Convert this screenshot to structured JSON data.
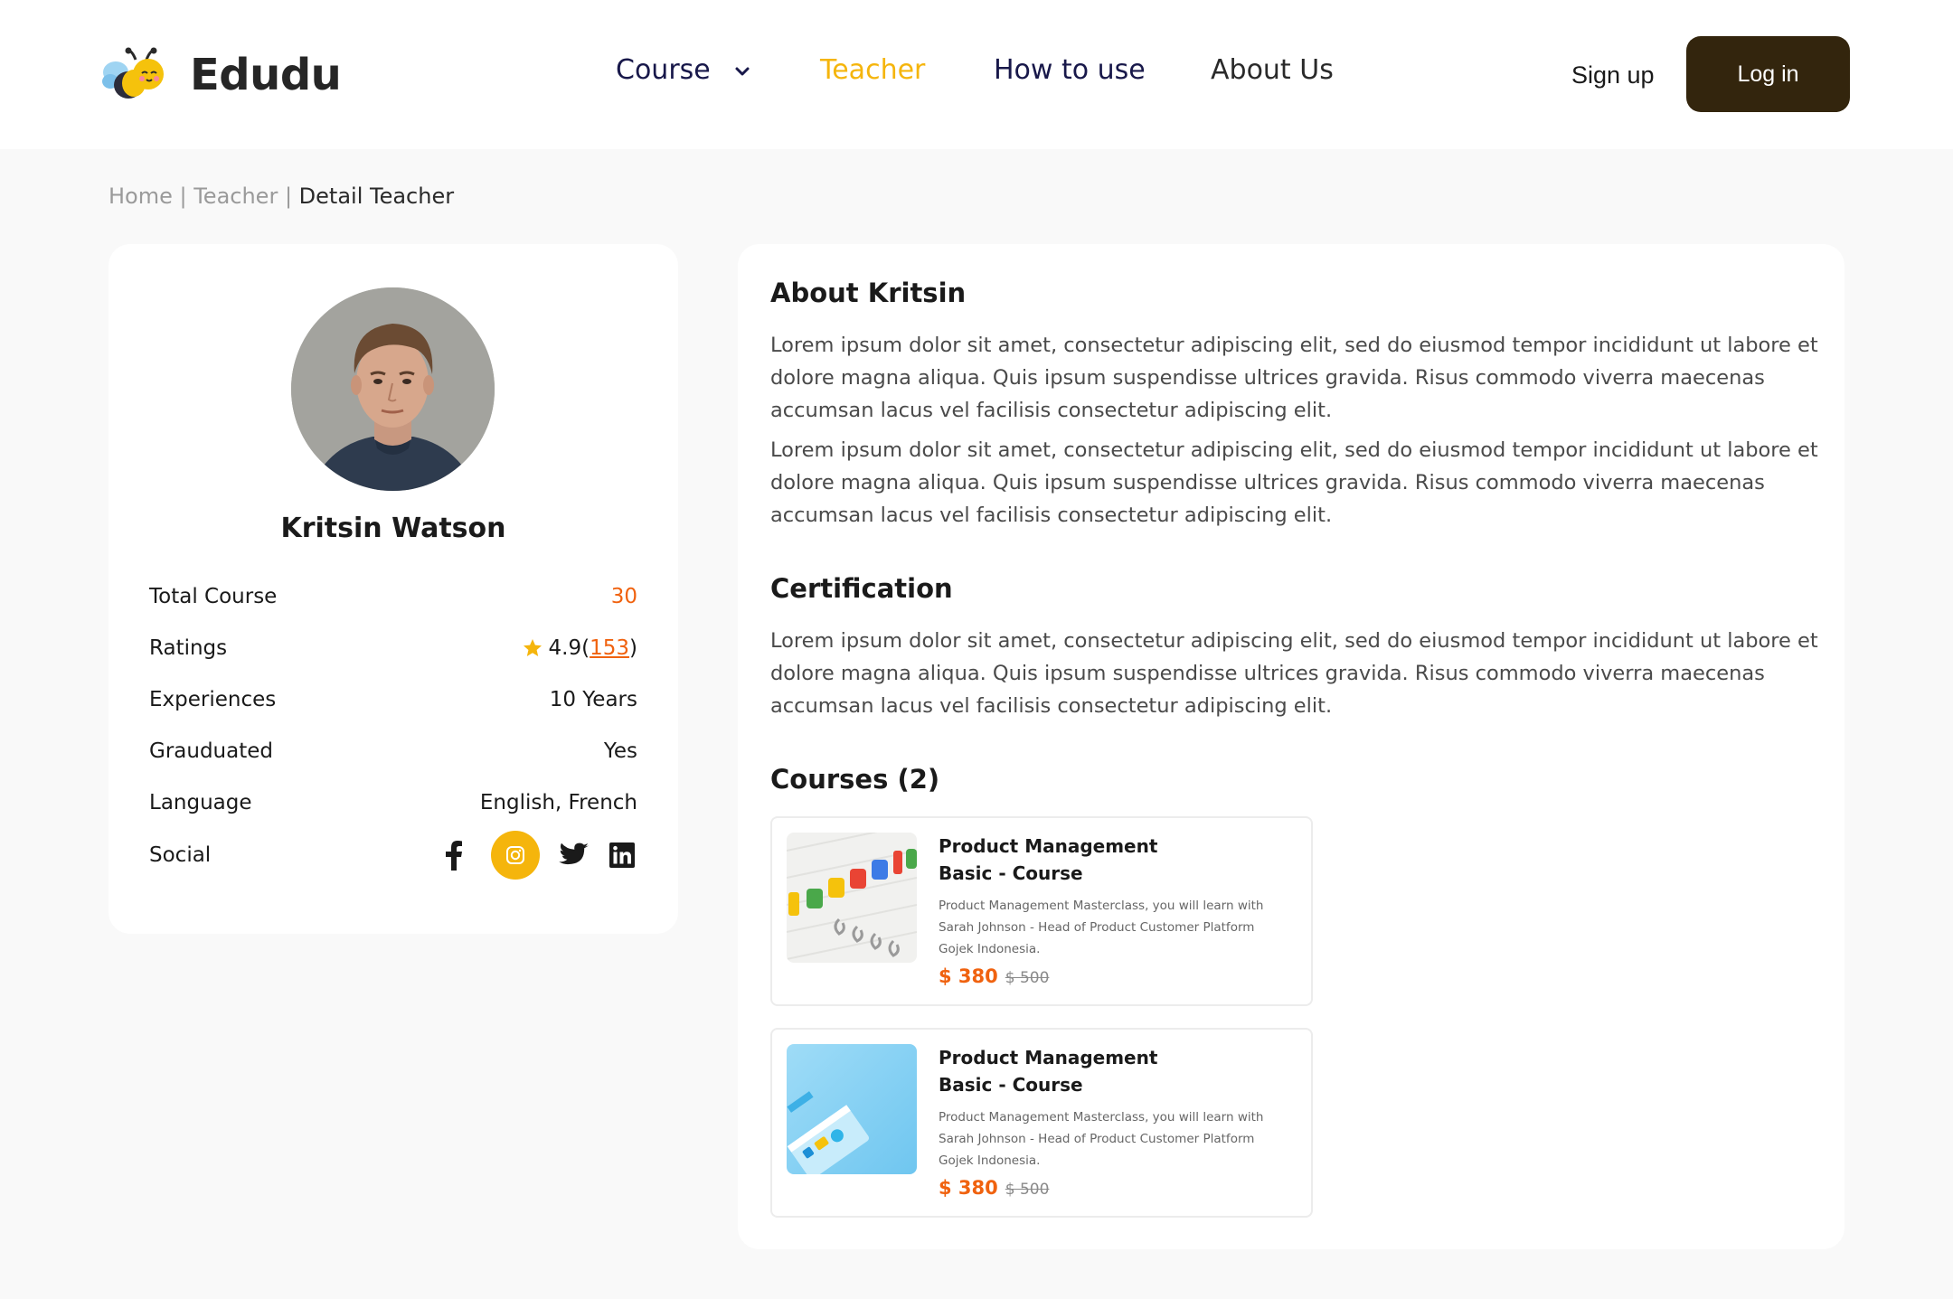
{
  "header": {
    "logo_text": "Edudu",
    "nav": {
      "course": "Course",
      "teacher": "Teacher",
      "how_to_use": "How to use",
      "about_us": "About Us"
    },
    "signup": "Sign up",
    "login": "Log in"
  },
  "breadcrumb": {
    "home": "Home",
    "sep1": " | ",
    "teacher": "Teacher",
    "sep2": " | ",
    "current": "Detail Teacher"
  },
  "profile": {
    "name": "Kritsin Watson",
    "stats": {
      "total_course_label": "Total Course",
      "total_course_value": "30",
      "ratings_label": "Ratings",
      "rating_value": "4.9",
      "rating_open": "(",
      "rating_count": "153",
      "rating_close": ")",
      "experiences_label": "Experiences",
      "experiences_value": "10 Years",
      "graduated_label": "Grauduated",
      "graduated_value": "Yes",
      "language_label": "Language",
      "language_value": "English, French",
      "social_label": "Social"
    },
    "social_icons": [
      "facebook-icon",
      "instagram-icon",
      "twitter-icon",
      "linkedin-icon"
    ]
  },
  "about": {
    "title": "About Kritsin",
    "paragraphs": [
      "Lorem ipsum dolor sit amet, consectetur adipiscing elit, sed do eiusmod tempor incididunt ut labore et dolore magna aliqua. Quis ipsum suspendisse ultrices gravida. Risus commodo viverra maecenas accumsan lacus vel facilisis consectetur adipiscing elit.",
      "Lorem ipsum dolor sit amet, consectetur adipiscing elit, sed do eiusmod tempor incididunt ut labore et dolore magna aliqua. Quis ipsum suspendisse ultrices gravida. Risus commodo viverra maecenas accumsan lacus vel facilisis consectetur adipiscing elit."
    ]
  },
  "certification": {
    "title": "Certification",
    "text": "Lorem ipsum dolor sit amet, consectetur adipiscing elit, sed do eiusmod tempor incididunt ut labore et dolore magna aliqua. Quis ipsum suspendisse ultrices gravida. Risus commodo viverra maecenas accumsan lacus vel facilisis consectetur adipiscing elit."
  },
  "courses": {
    "title": "Courses (2)",
    "items": [
      {
        "title_line1": "Product Management",
        "title_line2": "Basic - Course",
        "description": "Product Management Masterclass, you will learn with Sarah Johnson - Head of Product Customer Platform Gojek Indonesia.",
        "price": "$ 380",
        "old_price": "$ 500"
      },
      {
        "title_line1": "Product Management",
        "title_line2": "Basic - Course",
        "description": "Product Management Masterclass, you will learn with Sarah Johnson - Head of Product Customer Platform Gojek Indonesia.",
        "price": "$ 380",
        "old_price": "$ 500"
      }
    ]
  },
  "colors": {
    "accent_yellow": "#f5b50c",
    "accent_orange": "#f0620f",
    "login_bg": "#33250d",
    "nav_dark": "#18184a"
  }
}
